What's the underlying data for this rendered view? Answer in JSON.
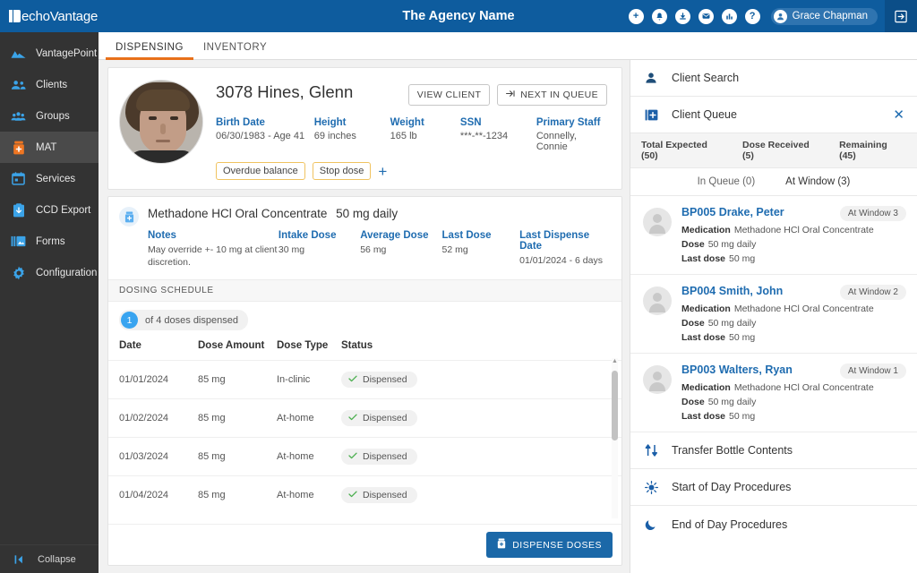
{
  "topbar": {
    "brand": "echoVantage",
    "agency_title": "The Agency Name",
    "user_name": "Grace Chapman",
    "icons": [
      "add-circle-icon",
      "bell-icon",
      "download-circle-icon",
      "envelope-icon",
      "chart-circle-icon",
      "help-circle-icon"
    ],
    "logout_icon": "logout-icon",
    "bg_color": "#0e5c9e"
  },
  "sidebar": {
    "items": [
      {
        "label": "VantagePoint",
        "icon": "mountain-icon",
        "active": false
      },
      {
        "label": "Clients",
        "icon": "people-icon",
        "active": false
      },
      {
        "label": "Groups",
        "icon": "group-icon",
        "active": false
      },
      {
        "label": "MAT",
        "icon": "pill-bottle-icon",
        "active": true
      },
      {
        "label": "Services",
        "icon": "calendar-icon",
        "active": false
      },
      {
        "label": "CCD Export",
        "icon": "clipboard-download-icon",
        "active": false
      },
      {
        "label": "Forms",
        "icon": "forms-icon",
        "active": false
      },
      {
        "label": "Configuration",
        "icon": "gear-icon",
        "active": false
      }
    ],
    "collapse_label": "Collapse",
    "collapse_icon": "collapse-left-icon"
  },
  "tabs": [
    {
      "label": "DISPENSING",
      "active": true
    },
    {
      "label": "INVENTORY",
      "active": false
    }
  ],
  "client": {
    "avatar": "client-photo",
    "name": "3078 Hines, Glenn",
    "buttons": [
      {
        "label": "VIEW CLIENT",
        "icon": ""
      },
      {
        "label": "NEXT IN QUEUE",
        "icon": "next-arrow-icon"
      }
    ],
    "meta": [
      {
        "key": "Birth Date",
        "value": "06/30/1983 - Age 41"
      },
      {
        "key": "Height",
        "value": "69 inches"
      },
      {
        "key": "Weight",
        "value": "165 lb"
      },
      {
        "key": "SSN",
        "value": "***-**-1234"
      },
      {
        "key": "Primary Staff",
        "value": "Connelly, Connie"
      }
    ],
    "tags": [
      "Overdue balance",
      "Stop dose"
    ],
    "add_tag_icon": "plus-icon"
  },
  "medication": {
    "icon": "pill-bottle-icon",
    "name": "Methadone HCl Oral Concentrate",
    "dose": "50 mg daily",
    "meta": [
      {
        "key": "Notes",
        "value": "May override +- 10 mg at client discretion."
      },
      {
        "key": "Intake Dose",
        "value": "30 mg"
      },
      {
        "key": "Average Dose",
        "value": "56 mg"
      },
      {
        "key": "Last Dose",
        "value": "52 mg"
      },
      {
        "key": "Last Dispense Date",
        "value": "01/01/2024 - 6 days"
      }
    ]
  },
  "schedule": {
    "section_title": "DOSING SCHEDULE",
    "count_number": "1",
    "count_text": "of 4 doses dispensed",
    "columns": [
      "Date",
      "Dose Amount",
      "Dose Type",
      "Status"
    ],
    "rows": [
      {
        "date": "01/01/2024",
        "amount": "85 mg",
        "type": "In-clinic",
        "status": "Dispensed"
      },
      {
        "date": "01/02/2024",
        "amount": "85 mg",
        "type": "At-home",
        "status": "Dispensed"
      },
      {
        "date": "01/03/2024",
        "amount": "85 mg",
        "type": "At-home",
        "status": "Dispensed"
      },
      {
        "date": "01/04/2024",
        "amount": "85 mg",
        "type": "At-home",
        "status": "Dispensed"
      }
    ],
    "dispense_button": "DISPENSE DOSES",
    "dispense_icon": "pill-bottle-icon"
  },
  "right_panel": {
    "client_search": {
      "label": "Client Search",
      "icon": "person-icon"
    },
    "client_queue": {
      "label": "Client Queue",
      "icon": "add-queue-icon",
      "close_icon": "close-icon"
    },
    "stats": [
      "Total Expected (50)",
      "Dose Received (5)",
      "Remaining (45)"
    ],
    "queue_tabs": [
      {
        "label": "In Queue (0)",
        "active": false
      },
      {
        "label": "At Window (3)",
        "active": true
      }
    ],
    "queue_items": [
      {
        "name": "BP005 Drake, Peter",
        "badge": "At Window 3",
        "medication_label": "Medication",
        "medication": "Methadone HCl Oral Concentrate",
        "dose_label": "Dose",
        "dose": "50 mg daily",
        "last_dose_label": "Last dose",
        "last_dose": "50 mg"
      },
      {
        "name": "BP004 Smith, John",
        "badge": "At Window 2",
        "medication_label": "Medication",
        "medication": "Methadone HCl Oral Concentrate",
        "dose_label": "Dose",
        "dose": "50 mg daily",
        "last_dose_label": "Last dose",
        "last_dose": "50 mg"
      },
      {
        "name": "BP003 Walters, Ryan",
        "badge": "At Window 1",
        "medication_label": "Medication",
        "medication": "Methadone HCl Oral Concentrate",
        "dose_label": "Dose",
        "dose": "50 mg daily",
        "last_dose_label": "Last dose",
        "last_dose": "50 mg"
      }
    ],
    "actions": [
      {
        "label": "Transfer Bottle Contents",
        "icon": "transfer-icon"
      },
      {
        "label": "Start of Day Procedures",
        "icon": "sun-icon"
      },
      {
        "label": "End of Day Procedures",
        "icon": "moon-icon"
      }
    ]
  }
}
